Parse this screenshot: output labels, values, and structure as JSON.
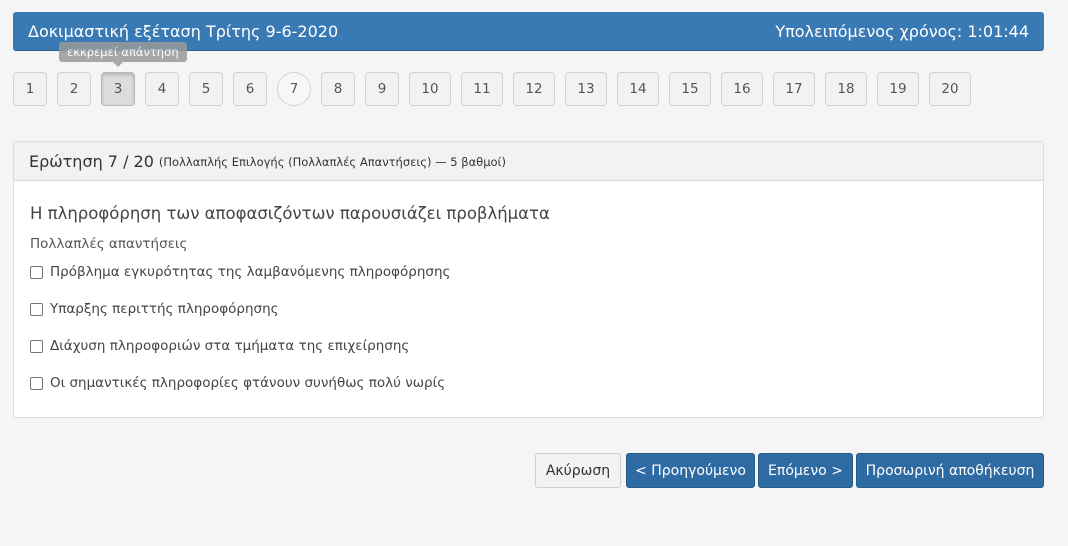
{
  "header": {
    "title": "Δοκιμαστική εξέταση Τρίτης 9-6-2020",
    "timer": "Υπολειπόμενος χρόνος: 1:01:44"
  },
  "tooltip": "εκκρεμεί απάντηση",
  "nav": {
    "questions": [
      "1",
      "2",
      "3",
      "4",
      "5",
      "6",
      "7",
      "8",
      "9",
      "10",
      "11",
      "12",
      "13",
      "14",
      "15",
      "16",
      "17",
      "18",
      "19",
      "20"
    ],
    "active": "3",
    "current": "7"
  },
  "question": {
    "title": "Ερώτηση 7 / 20",
    "meta": "(Πολλαπλής Επιλογής (Πολλαπλές Απαντήσεις) — 5 βαθμοί)",
    "text": "Η πληροφόρηση των αποφασιζόντων παρουσιάζει προβλήματα",
    "subtitle": "Πολλαπλές απαντήσεις",
    "options": [
      "Πρόβλημα εγκυρότητας της λαμβανόμενης πληροφόρησης",
      "Υπαρξης περιττής πληροφόρησης",
      "Διάχυση πληροφοριών στα τμήματα της επιχείρησης",
      "Οι σημαντικές πληροφορίες φτάνουν συνήθως πολύ νωρίς"
    ]
  },
  "buttons": {
    "cancel": "Ακύρωση",
    "prev": "< Προηγούμενο",
    "next": "Επόμενο >",
    "save": "Προσωρινή αποθήκευση"
  }
}
